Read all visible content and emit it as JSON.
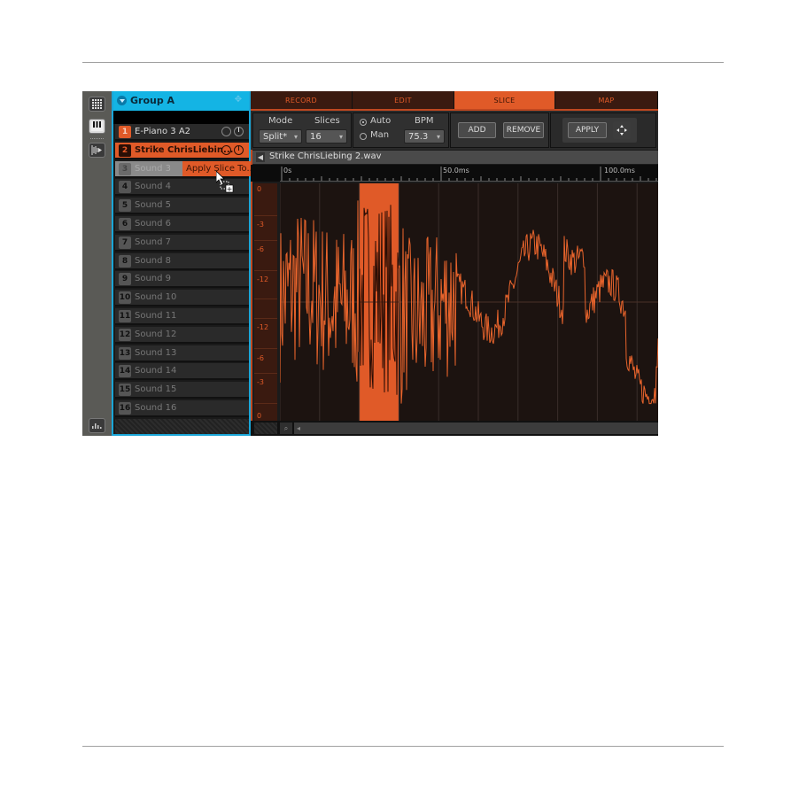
{
  "page": {
    "top_rule": true,
    "bottom_rule": true
  },
  "side_column": {
    "icons": [
      "pad-grid-icon",
      "keyboard-icon",
      "slice-waveform-icon",
      "mixer-icon"
    ]
  },
  "group": {
    "title": "Group A",
    "sounds": [
      {
        "num": "1",
        "name": "E-Piano 3 A2",
        "state": "on"
      },
      {
        "num": "2",
        "name": "Strike ChrisLiebin...",
        "state": "selected"
      },
      {
        "num": "3",
        "name": "Sound 3",
        "state": "drag"
      },
      {
        "num": "4",
        "name": "Sound 4",
        "state": "empty"
      },
      {
        "num": "5",
        "name": "Sound 5",
        "state": "empty"
      },
      {
        "num": "6",
        "name": "Sound 6",
        "state": "empty"
      },
      {
        "num": "7",
        "name": "Sound 7",
        "state": "empty"
      },
      {
        "num": "8",
        "name": "Sound 8",
        "state": "empty"
      },
      {
        "num": "9",
        "name": "Sound 9",
        "state": "empty"
      },
      {
        "num": "10",
        "name": "Sound 10",
        "state": "empty"
      },
      {
        "num": "11",
        "name": "Sound 11",
        "state": "empty"
      },
      {
        "num": "12",
        "name": "Sound 12",
        "state": "empty"
      },
      {
        "num": "13",
        "name": "Sound 13",
        "state": "empty"
      },
      {
        "num": "14",
        "name": "Sound 14",
        "state": "empty"
      },
      {
        "num": "15",
        "name": "Sound 15",
        "state": "empty"
      },
      {
        "num": "16",
        "name": "Sound 16",
        "state": "empty"
      }
    ],
    "drag_tooltip": "Apply Slice To..."
  },
  "tabs": [
    {
      "label": "RECORD",
      "active": false
    },
    {
      "label": "EDIT",
      "active": false
    },
    {
      "label": "SLICE",
      "active": true
    },
    {
      "label": "MAP",
      "active": false
    }
  ],
  "controls": {
    "mode_label": "Mode",
    "mode_value": "Split*",
    "slices_label": "Slices",
    "slices_value": "16",
    "auto_label": "Auto",
    "man_label": "Man",
    "detect_mode": "Auto",
    "bpm_label": "BPM",
    "bpm_value": "75.3",
    "add_label": "ADD",
    "remove_label": "REMOVE",
    "apply_label": "APPLY"
  },
  "file": {
    "name": "Strike ChrisLiebing 2.wav"
  },
  "ruler": {
    "labels": [
      "0s",
      "50.0ms",
      "100.0ms"
    ]
  },
  "db_scale": [
    "0",
    "-3",
    "-6",
    "-12",
    "-12",
    "-6",
    "-3",
    "0"
  ],
  "colors": {
    "accent": "#e05a28",
    "group": "#14b4e4",
    "wave_bg": "#1c1310"
  },
  "waveform": {
    "selected_slice": 2,
    "slice_count": 16
  }
}
